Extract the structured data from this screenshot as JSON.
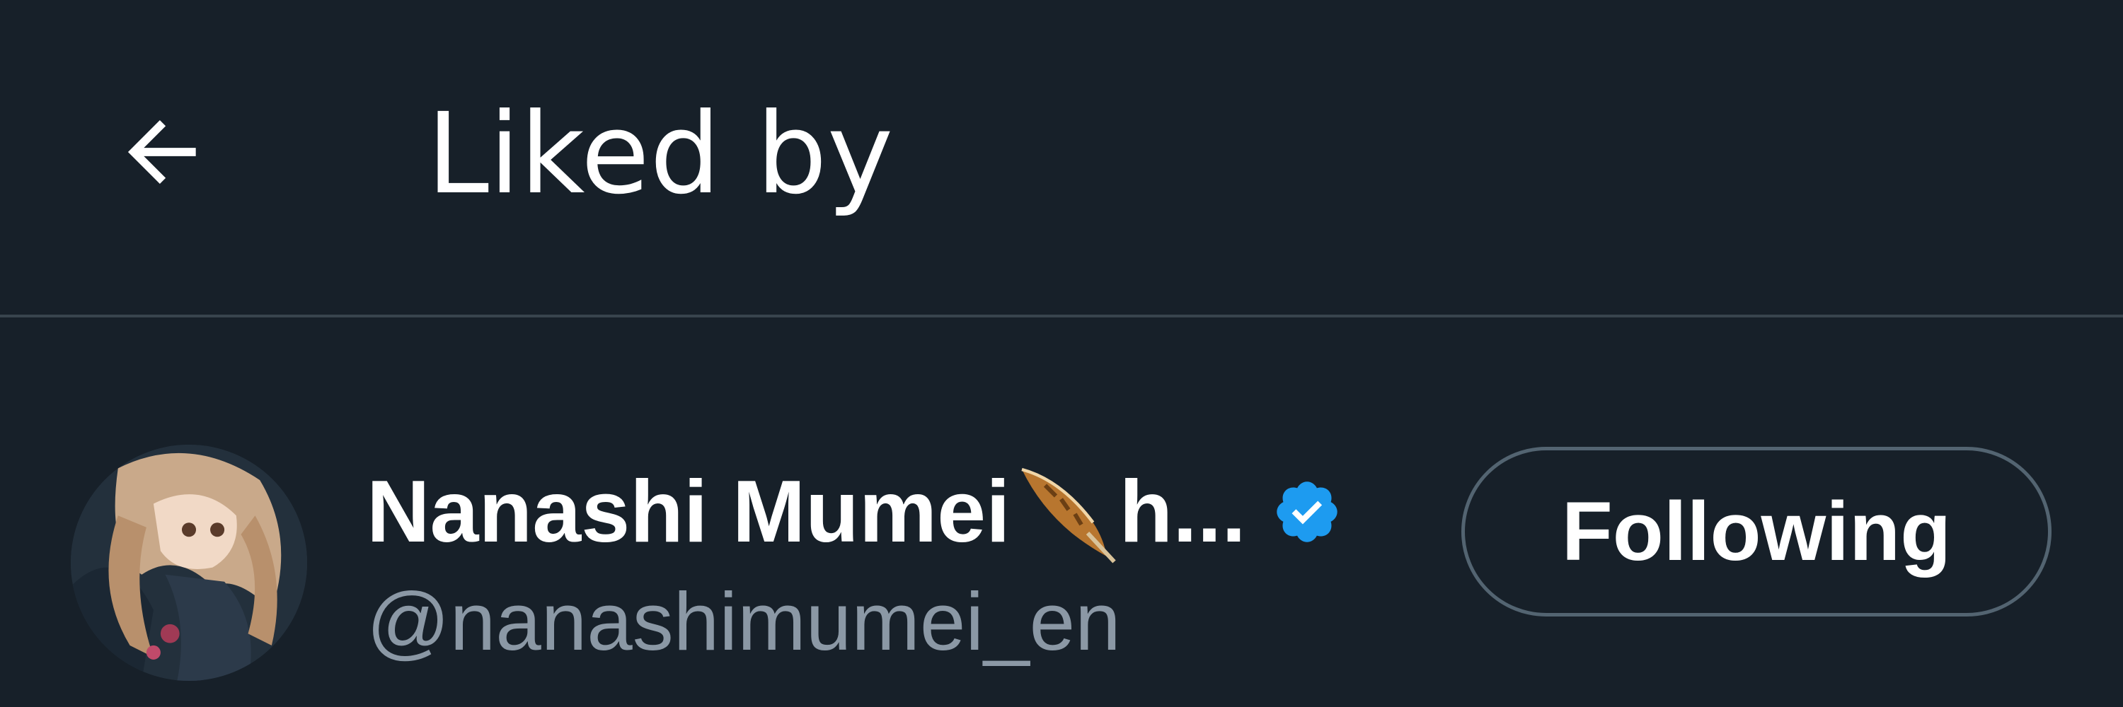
{
  "header": {
    "back_icon": "arrow-left-icon",
    "title": "Liked by"
  },
  "users": [
    {
      "display_name": "Nanashi Mumei",
      "name_emoji": "feather-icon",
      "name_suffix": "h...",
      "verified": true,
      "verified_icon": "verified-badge-icon",
      "handle": "@nanashimumei_en",
      "follow_label": "Following"
    }
  ],
  "colors": {
    "background": "#15202b",
    "text_primary": "#ffffff",
    "text_secondary": "#8b98a5",
    "divider": "#38444d",
    "button_border": "#536471",
    "verified": "#1d9bf0"
  }
}
